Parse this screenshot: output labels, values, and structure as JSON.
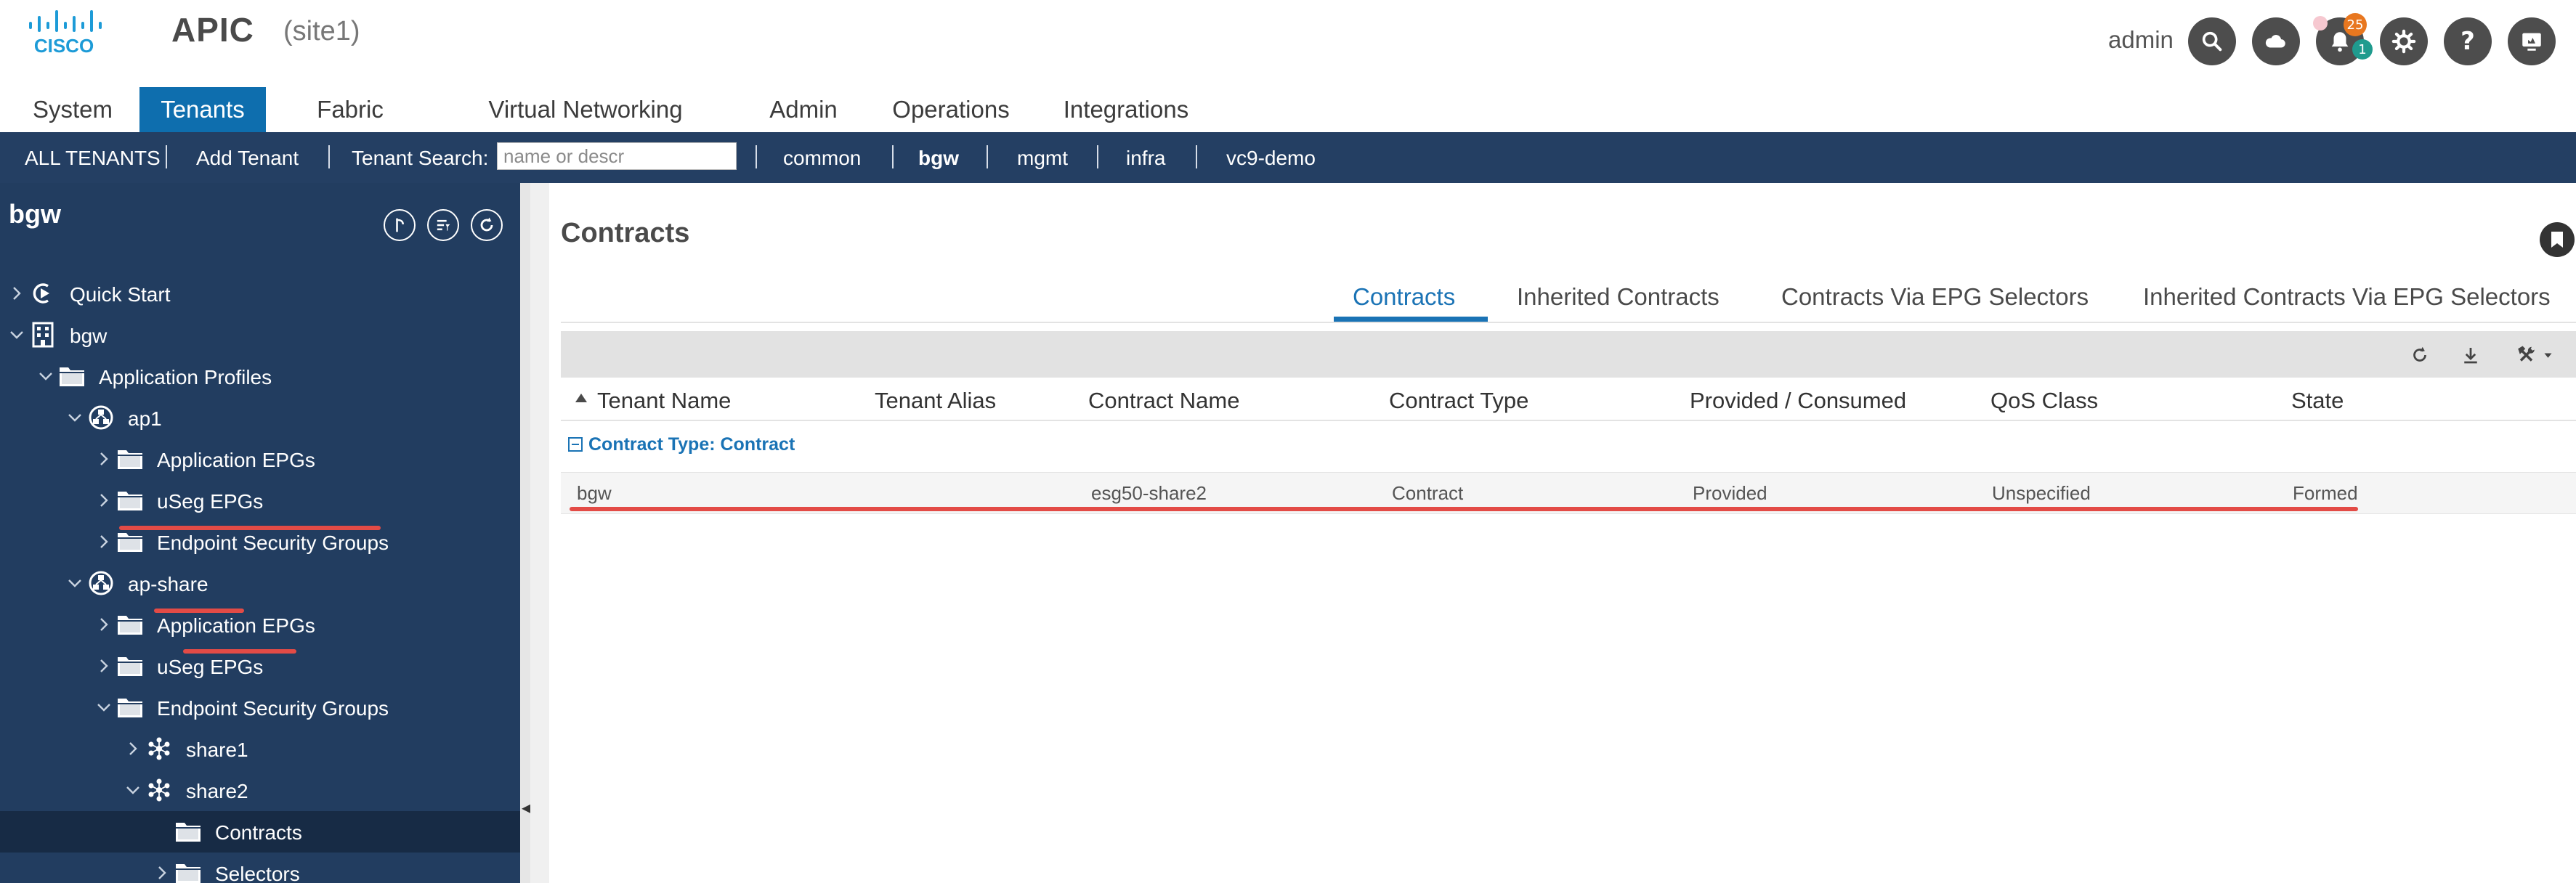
{
  "header": {
    "brand": "CISCO",
    "app_title": "APIC",
    "site": "(site1)",
    "user": "admin",
    "alert_count": "25",
    "info_count": "1",
    "icons": [
      "search-icon",
      "cloud-icon",
      "bell-icon",
      "gear-icon",
      "help-icon",
      "display-icon"
    ]
  },
  "main_tabs": [
    {
      "label": "System"
    },
    {
      "label": "Tenants",
      "active": true
    },
    {
      "label": "Fabric"
    },
    {
      "label": "Virtual Networking"
    },
    {
      "label": "Admin"
    },
    {
      "label": "Operations"
    },
    {
      "label": "Integrations"
    }
  ],
  "subnav": {
    "all_tenants": "ALL TENANTS",
    "add_tenant": "Add Tenant",
    "search_label": "Tenant Search:",
    "search_placeholder": "name or descr",
    "tenants": [
      "common",
      "bgw",
      "mgmt",
      "infra",
      "vc9-demo"
    ],
    "active_tenant": "bgw"
  },
  "sidebar": {
    "title": "bgw",
    "tree": [
      {
        "label": "Quick Start",
        "icon": "quick-start-icon",
        "expanded": false
      },
      {
        "label": "bgw",
        "icon": "tenant-icon",
        "expanded": true
      },
      {
        "label": "Application Profiles",
        "icon": "folder-icon",
        "expanded": true
      },
      {
        "label": "ap1",
        "icon": "app-profile-icon",
        "expanded": true
      },
      {
        "label": "Application EPGs",
        "icon": "folder-icon",
        "expanded": false
      },
      {
        "label": "uSeg EPGs",
        "icon": "folder-icon",
        "expanded": false
      },
      {
        "label": "Endpoint Security Groups",
        "icon": "folder-icon",
        "expanded": false
      },
      {
        "label": "ap-share",
        "icon": "app-profile-icon",
        "expanded": true
      },
      {
        "label": "Application EPGs",
        "icon": "folder-icon",
        "expanded": false
      },
      {
        "label": "uSeg EPGs",
        "icon": "folder-icon",
        "expanded": false
      },
      {
        "label": "Endpoint Security Groups",
        "icon": "folder-icon",
        "expanded": true
      },
      {
        "label": "share1",
        "icon": "esg-icon",
        "expanded": false
      },
      {
        "label": "share2",
        "icon": "esg-icon",
        "expanded": true
      },
      {
        "label": "Contracts",
        "icon": "folder-icon",
        "selected": true
      },
      {
        "label": "Selectors",
        "icon": "folder-icon",
        "expanded": false
      }
    ]
  },
  "content": {
    "title": "Contracts",
    "tabs": [
      {
        "label": "Contracts",
        "active": true
      },
      {
        "label": "Inherited Contracts"
      },
      {
        "label": "Contracts Via EPG Selectors"
      },
      {
        "label": "Inherited Contracts Via EPG Selectors"
      }
    ],
    "table": {
      "columns": [
        "Tenant Name",
        "Tenant Alias",
        "Contract Name",
        "Contract Type",
        "Provided / Consumed",
        "QoS Class",
        "State"
      ],
      "sort_column": "Tenant Name",
      "group_label": "Contract Type: Contract",
      "rows": [
        [
          "bgw",
          "",
          "esg50-share2",
          "Contract",
          "Provided",
          "Unspecified",
          "Formed"
        ]
      ]
    }
  },
  "colors": {
    "nav_dark": "#243f63",
    "tab_active": "#0e6eae",
    "link_blue": "#1a73b5",
    "highlight_red": "#e34b46"
  }
}
